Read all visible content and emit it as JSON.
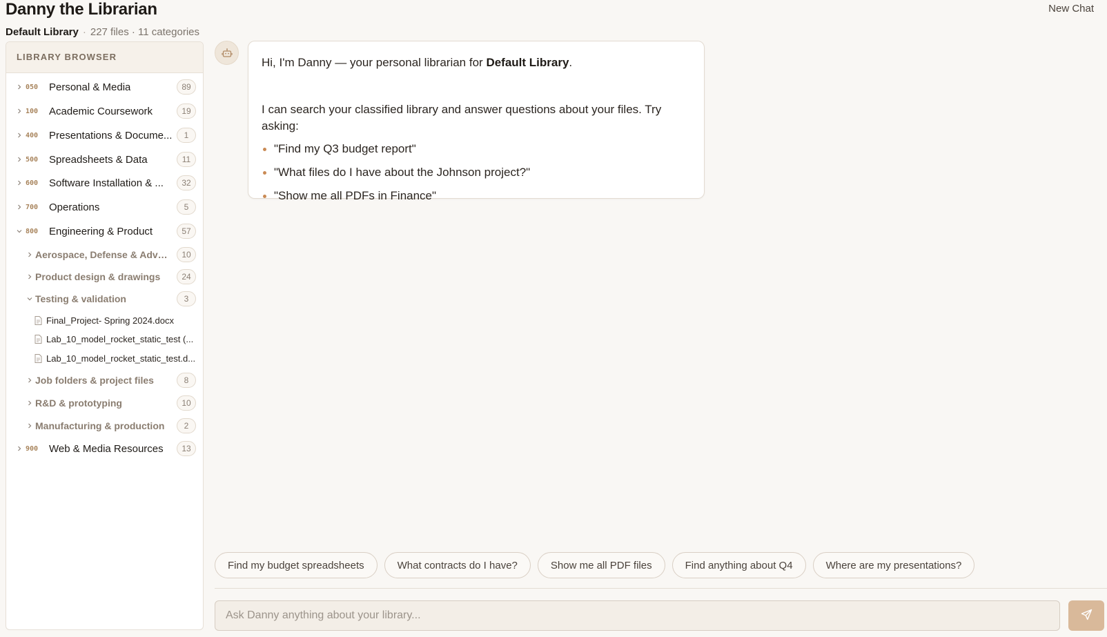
{
  "header": {
    "title": "Danny the Librarian",
    "new_chat_label": "New Chat",
    "library_name": "Default Library",
    "separator": "·",
    "stats": "227 files · 11 categories"
  },
  "sidebar": {
    "heading": "LIBRARY BROWSER",
    "categories": [
      {
        "code": "050",
        "label": "Personal & Media",
        "count": "89"
      },
      {
        "code": "100",
        "label": "Academic Coursework",
        "count": "19"
      },
      {
        "code": "400",
        "label": "Presentations & Docume...",
        "count": "1"
      },
      {
        "code": "500",
        "label": "Spreadsheets & Data",
        "count": "11"
      },
      {
        "code": "600",
        "label": "Software Installation & ...",
        "count": "32"
      },
      {
        "code": "700",
        "label": "Operations",
        "count": "5"
      },
      {
        "code": "800",
        "label": "Engineering & Product",
        "count": "57"
      },
      {
        "code": "900",
        "label": "Web & Media Resources",
        "count": "13"
      }
    ],
    "subcategories": [
      {
        "label": "Aerospace, Defense & Advan...",
        "count": "10"
      },
      {
        "label": "Product design & drawings",
        "count": "24"
      },
      {
        "label": "Testing & validation",
        "count": "3"
      },
      {
        "label": "Job folders & project files",
        "count": "8"
      },
      {
        "label": "R&D & prototyping",
        "count": "10"
      },
      {
        "label": "Manufacturing & production",
        "count": "2"
      }
    ],
    "files": [
      "Final_Project- Spring 2024.docx",
      "Lab_10_model_rocket_static_test (...",
      "Lab_10_model_rocket_static_test.d..."
    ]
  },
  "chat": {
    "greeting_pre": "Hi, I'm Danny — your personal librarian for ",
    "greeting_bold": "Default Library",
    "greeting_post": ".",
    "intro": "I can search your classified library and answer questions about your files. Try asking:",
    "examples": [
      "\"Find my Q3 budget report\"",
      "\"What files do I have about the Johnson project?\"",
      "\"Show me all PDFs in Finance\""
    ]
  },
  "suggestions": [
    "Find my budget spreadsheets",
    "What contracts do I have?",
    "Show me all PDF files",
    "Find anything about Q4",
    "Where are my presentations?"
  ],
  "composer": {
    "placeholder": "Ask Danny anything about your library...",
    "value": ""
  },
  "icons": {
    "avatar": "robot-icon",
    "send": "send-icon",
    "collapsed": "chevron-right-icon",
    "expanded": "chevron-down-icon",
    "file": "file-icon"
  },
  "colors": {
    "accent": "#c98a54",
    "code": "#a8845c",
    "send_button": "#d9b99a",
    "background": "#f9f7f4"
  }
}
